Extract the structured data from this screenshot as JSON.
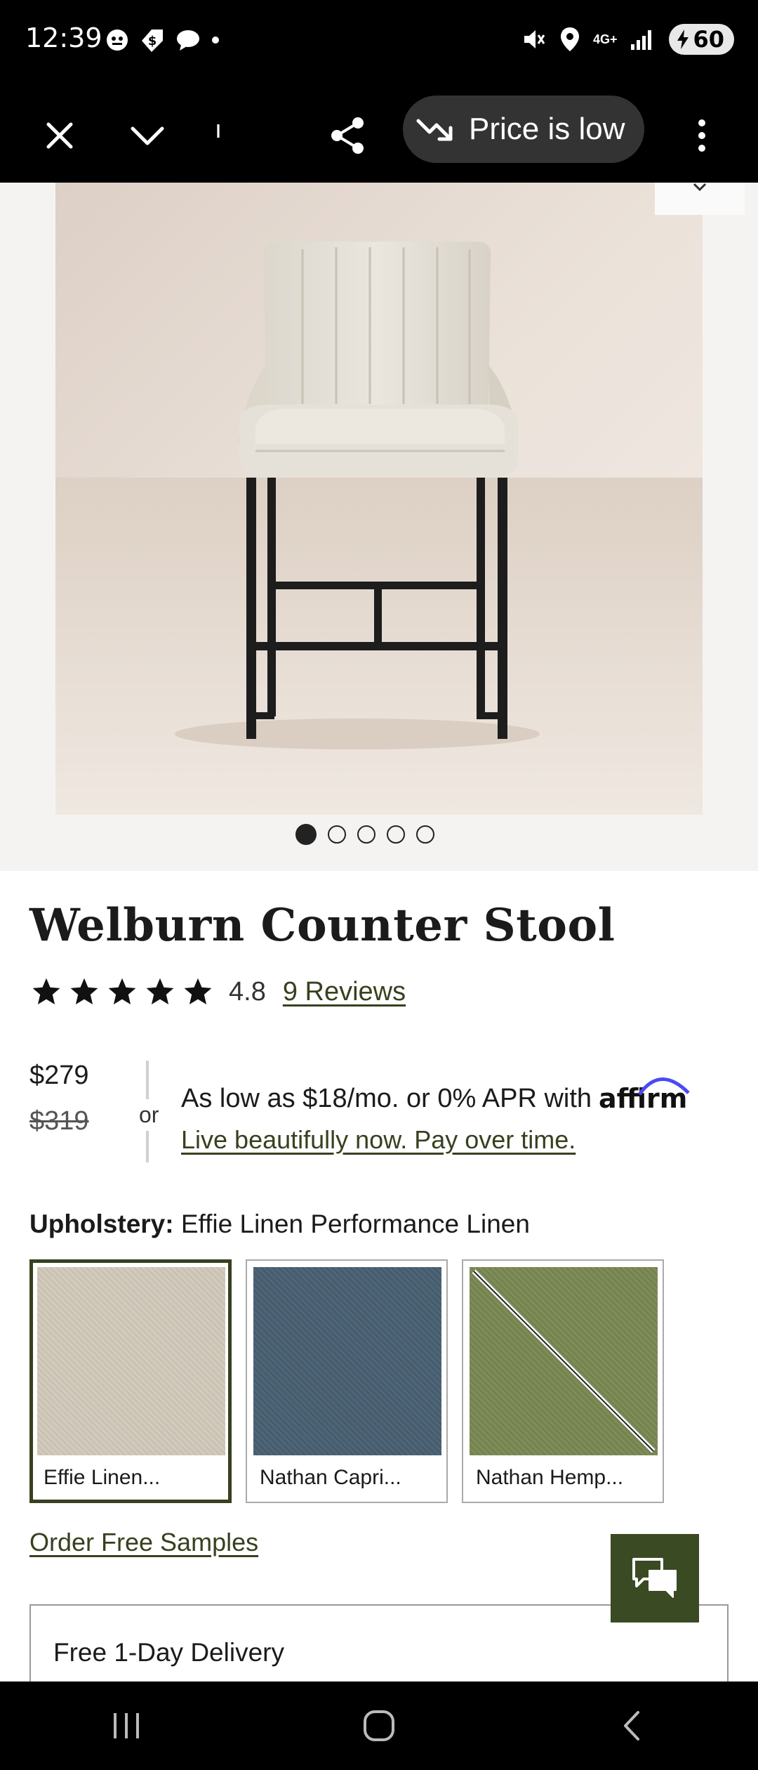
{
  "status_bar": {
    "time": "12:39",
    "battery": "60",
    "network": "4G+"
  },
  "toolbar": {
    "partial_text": "ı",
    "price_pill_label": "Price is low"
  },
  "gallery": {
    "image_alt": "Welburn Counter Stool product photo",
    "dot_count": 5,
    "active_dot": 0
  },
  "product": {
    "title": "Welburn Counter Stool",
    "rating": "4.8",
    "star_count": 5,
    "reviews_link": "9 Reviews",
    "price_current": "$279",
    "price_original": "$319",
    "or_label": "or",
    "affirm_text": "As low as $18/mo. or 0% APR with",
    "affirm_brand": "affirm",
    "affirm_link": "Live beautifully now. Pay over time.",
    "upholstery_label": "Upholstery:",
    "upholstery_value": "Effie Linen Performance Linen",
    "swatches": [
      {
        "label": "Effie Linen...",
        "color": "#d1c8b9",
        "selected": true,
        "unavailable": false
      },
      {
        "label": "Nathan Capri...",
        "color": "#4b6173",
        "selected": false,
        "unavailable": false
      },
      {
        "label": "Nathan Hemp...",
        "color": "#7c8a56",
        "selected": false,
        "unavailable": true
      }
    ],
    "samples_link": "Order Free Samples",
    "delivery_label": "Free 1-Day Delivery"
  },
  "colors": {
    "accent_green": "#37411f",
    "chat_button": "#3a4a23"
  }
}
